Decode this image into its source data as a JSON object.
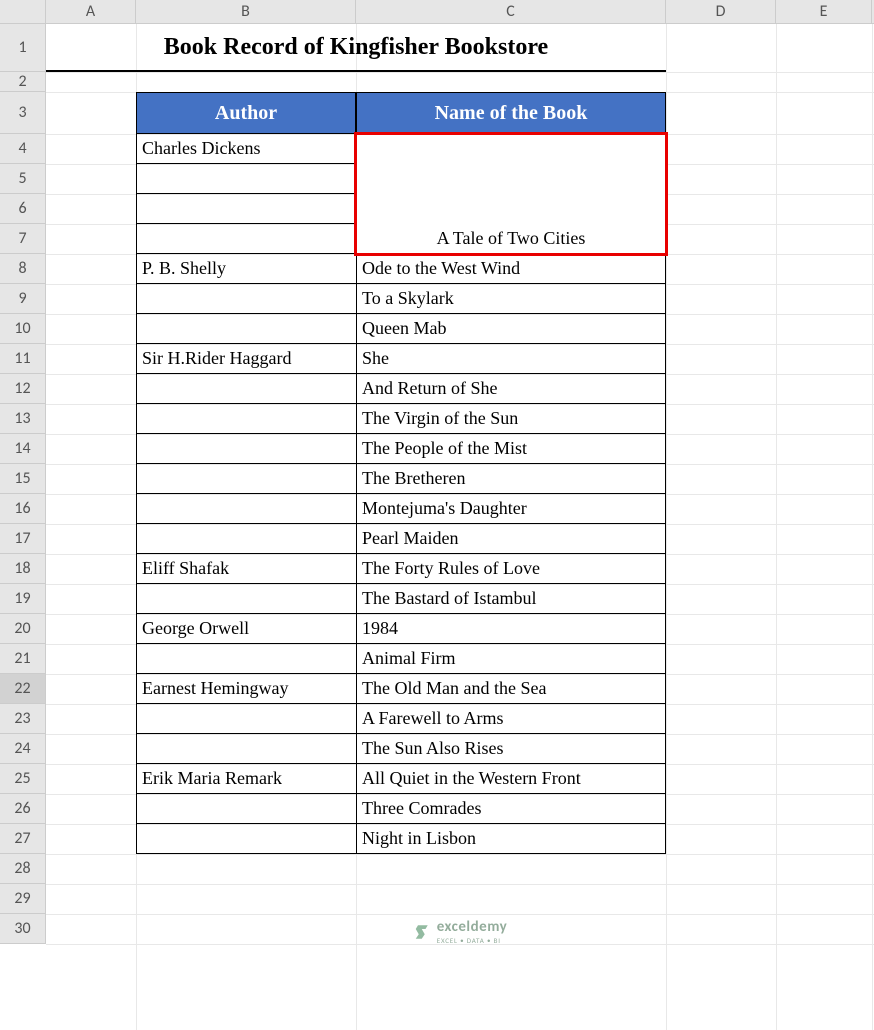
{
  "columns": [
    "A",
    "B",
    "C",
    "D",
    "E"
  ],
  "rows": [
    "1",
    "2",
    "3",
    "4",
    "5",
    "6",
    "7",
    "8",
    "9",
    "10",
    "11",
    "12",
    "13",
    "14",
    "15",
    "16",
    "17",
    "18",
    "19",
    "20",
    "21",
    "22",
    "23",
    "24",
    "25",
    "26",
    "27",
    "28",
    "29",
    "30"
  ],
  "title": "Book Record of Kingfisher Bookstore",
  "headers": {
    "author": "Author",
    "book": "Name of the Book"
  },
  "merged_cell_value": "A Tale of Two Cities",
  "selected_row": "22",
  "chart_data": {
    "type": "table",
    "columns": [
      "Author",
      "Name of the Book"
    ],
    "rows": [
      {
        "author": "Charles Dickens",
        "book_merged_range": "C4:C7",
        "book": "A Tale of Two Cities"
      },
      {
        "author": "P. B. Shelly",
        "book": "Ode to the West Wind"
      },
      {
        "author": "",
        "book": "To a Skylark"
      },
      {
        "author": "",
        "book": "Queen Mab"
      },
      {
        "author": "Sir H.Rider Haggard",
        "book": "She"
      },
      {
        "author": "",
        "book": "And Return of She"
      },
      {
        "author": "",
        "book": "The Virgin of the Sun"
      },
      {
        "author": "",
        "book": "The People of the Mist"
      },
      {
        "author": "",
        "book": "The Bretheren"
      },
      {
        "author": "",
        "book": "Montejuma's Daughter"
      },
      {
        "author": "",
        "book": "Pearl Maiden"
      },
      {
        "author": "Eliff Shafak",
        "book": "The Forty Rules of Love"
      },
      {
        "author": "",
        "book": "The Bastard of Istambul"
      },
      {
        "author": "George Orwell",
        "book": "1984"
      },
      {
        "author": "",
        "book": "Animal Firm"
      },
      {
        "author": "Earnest Hemingway",
        "book": "The Old Man and the Sea"
      },
      {
        "author": "",
        "book": "A Farewell to Arms"
      },
      {
        "author": "",
        "book": "The Sun Also Rises"
      },
      {
        "author": "Erik Maria Remark",
        "book": "All Quiet in the Western Front"
      },
      {
        "author": "",
        "book": "Three Comrades"
      },
      {
        "author": "",
        "book": "Night in Lisbon"
      }
    ]
  },
  "data_rows": [
    {
      "author": "Charles Dickens",
      "book": ""
    },
    {
      "author": "",
      "book": ""
    },
    {
      "author": "",
      "book": ""
    },
    {
      "author": "",
      "book": ""
    },
    {
      "author": "P. B. Shelly",
      "book": "Ode to the West Wind"
    },
    {
      "author": "",
      "book": "To a Skylark"
    },
    {
      "author": "",
      "book": "Queen Mab"
    },
    {
      "author": "Sir H.Rider Haggard",
      "book": "She"
    },
    {
      "author": "",
      "book": "And Return of She"
    },
    {
      "author": "",
      "book": "The Virgin of the Sun"
    },
    {
      "author": "",
      "book": "The People of the Mist"
    },
    {
      "author": "",
      "book": "The Bretheren"
    },
    {
      "author": "",
      "book": "Montejuma's Daughter"
    },
    {
      "author": "",
      "book": "Pearl Maiden"
    },
    {
      "author": "Eliff Shafak",
      "book": "The Forty Rules of Love"
    },
    {
      "author": "",
      "book": "The Bastard of Istambul"
    },
    {
      "author": "George Orwell",
      "book": "1984"
    },
    {
      "author": "",
      "book": "Animal Firm"
    },
    {
      "author": "Earnest Hemingway",
      "book": "The Old Man and the Sea"
    },
    {
      "author": "",
      "book": "A Farewell to Arms"
    },
    {
      "author": "",
      "book": "The Sun Also Rises"
    },
    {
      "author": "Erik Maria Remark",
      "book": "All Quiet in the Western Front"
    },
    {
      "author": "",
      "book": "Three Comrades"
    },
    {
      "author": "",
      "book": "Night in Lisbon"
    }
  ],
  "watermark": {
    "brand": "exceldemy",
    "tagline": "EXCEL • DATA • BI"
  }
}
